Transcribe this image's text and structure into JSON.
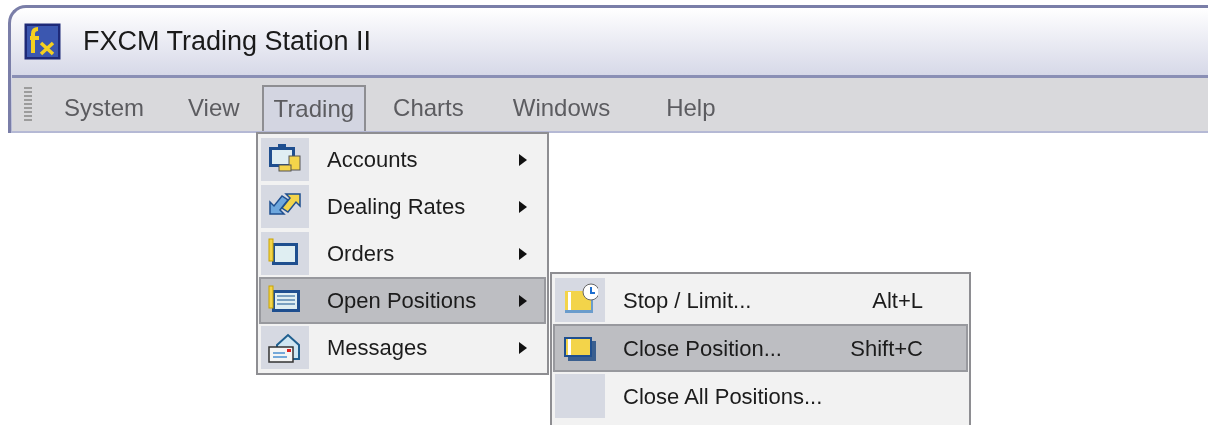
{
  "window": {
    "title": "FXCM Trading Station II"
  },
  "menu_bar": [
    {
      "label": "System",
      "selected": false
    },
    {
      "label": "View",
      "selected": false
    },
    {
      "label": "Trading",
      "selected": true
    },
    {
      "label": "Charts",
      "selected": false
    },
    {
      "label": "Windows",
      "selected": false
    },
    {
      "label": "Help",
      "selected": false
    }
  ],
  "trading_menu": [
    {
      "label": "Accounts",
      "selected": false
    },
    {
      "label": "Dealing Rates",
      "selected": false
    },
    {
      "label": "Orders",
      "selected": false
    },
    {
      "label": "Open Positions",
      "selected": true
    },
    {
      "label": "Messages",
      "selected": false
    }
  ],
  "open_positions_submenu": [
    {
      "label": "Stop / Limit...",
      "shortcut": "Alt+L",
      "selected": false
    },
    {
      "label": "Close Position...",
      "shortcut": "Shift+C",
      "selected": true
    },
    {
      "label": "Close All Positions...",
      "selected": false
    }
  ]
}
